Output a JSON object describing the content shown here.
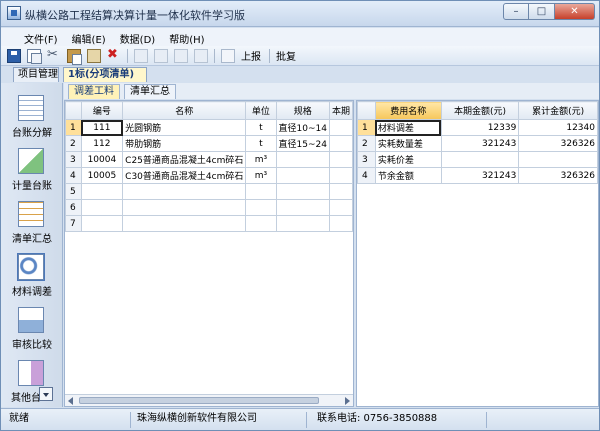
{
  "window": {
    "title": "纵横公路工程结算决算计量一体化软件学习版",
    "controls": [
      "–",
      "□",
      "✕"
    ]
  },
  "menu": [
    {
      "label": "文件(F)"
    },
    {
      "label": "编辑(E)"
    },
    {
      "label": "数据(D)"
    },
    {
      "label": "帮助(H)"
    }
  ],
  "toolbar": {
    "report_label": "上报",
    "approve_label": "批复"
  },
  "doc_tabs": {
    "project": "项目管理",
    "bid": "1标(分项清单)"
  },
  "sidebar": {
    "items": [
      {
        "label": "台账分解",
        "icon": "ledger-grid-icon"
      },
      {
        "label": "计量台账",
        "icon": "measurement-calc-icon"
      },
      {
        "label": "清单汇总",
        "icon": "list-summary-icon"
      },
      {
        "label": "材料调差",
        "icon": "material-adjust-icon"
      },
      {
        "label": "审核比较",
        "icon": "audit-compare-icon"
      },
      {
        "label": "其他台",
        "icon": "other-ledger-icon"
      }
    ]
  },
  "sub_tabs": {
    "material": "调差工料",
    "summary": "清单汇总"
  },
  "left_table": {
    "columns": [
      "编号",
      "名称",
      "单位",
      "规格",
      "本期"
    ],
    "rows": [
      {
        "row": "1",
        "code": "111",
        "name": "光圆钢筋",
        "unit": "t",
        "spec": "直径10~14"
      },
      {
        "row": "2",
        "code": "112",
        "name": "带肋钢筋",
        "unit": "t",
        "spec": "直径15~24"
      },
      {
        "row": "3",
        "code": "10004",
        "name": "C25普通商品混凝土4cm碎石",
        "unit": "m³",
        "spec": ""
      },
      {
        "row": "4",
        "code": "10005",
        "name": "C30普通商品混凝土4cm碎石",
        "unit": "m³",
        "spec": ""
      },
      {
        "row": "5",
        "code": "",
        "name": "",
        "unit": "",
        "spec": ""
      },
      {
        "row": "6",
        "code": "",
        "name": "",
        "unit": "",
        "spec": ""
      },
      {
        "row": "7",
        "code": "",
        "name": "",
        "unit": "",
        "spec": ""
      }
    ]
  },
  "right_table": {
    "columns": [
      "费用名称",
      "本期金额(元)",
      "累计金额(元)"
    ],
    "rows": [
      {
        "row": "1",
        "name": "材料调差",
        "current": "12339",
        "total": "12340"
      },
      {
        "row": "2",
        "name": "实耗数量差",
        "current": "321243",
        "total": "326326"
      },
      {
        "row": "3",
        "name": "实耗价差",
        "current": "",
        "total": ""
      },
      {
        "row": "4",
        "name": "节余金额",
        "current": "321243",
        "total": "326326"
      }
    ]
  },
  "status": {
    "ready": "就绪",
    "company": "珠海纵横创新软件有限公司",
    "phone": "联系电话: 0756-3850888"
  },
  "colors": {
    "selection": "#ffe09a",
    "active_tab": "#fff2b8",
    "frame": "#d4e0ef"
  }
}
